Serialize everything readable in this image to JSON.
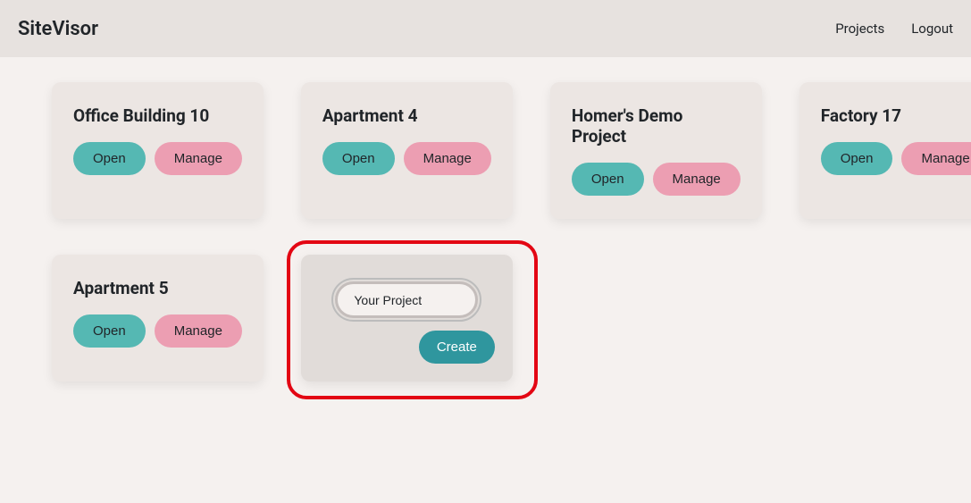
{
  "app": {
    "title": "SiteVisor"
  },
  "nav": {
    "projects": "Projects",
    "logout": "Logout"
  },
  "projects": [
    {
      "title": "Office Building 10",
      "open": "Open",
      "manage": "Manage"
    },
    {
      "title": "Apartment 4",
      "open": "Open",
      "manage": "Manage"
    },
    {
      "title": "Homer's Demo Project",
      "open": "Open",
      "manage": "Manage"
    },
    {
      "title": "Factory 17",
      "open": "Open",
      "manage": "Manage"
    },
    {
      "title": "Apartment 5",
      "open": "Open",
      "manage": "Manage"
    }
  ],
  "newProject": {
    "inputValue": "Your Project",
    "createLabel": "Create"
  },
  "colors": {
    "headerBg": "#e7e2df",
    "bodyBg": "#f5f1ef",
    "cardBg": "#ece6e3",
    "openBtn": "#55b8b3",
    "manageBtn": "#ec9eb2",
    "createBtn": "#2f969e",
    "highlight": "#e30613"
  }
}
